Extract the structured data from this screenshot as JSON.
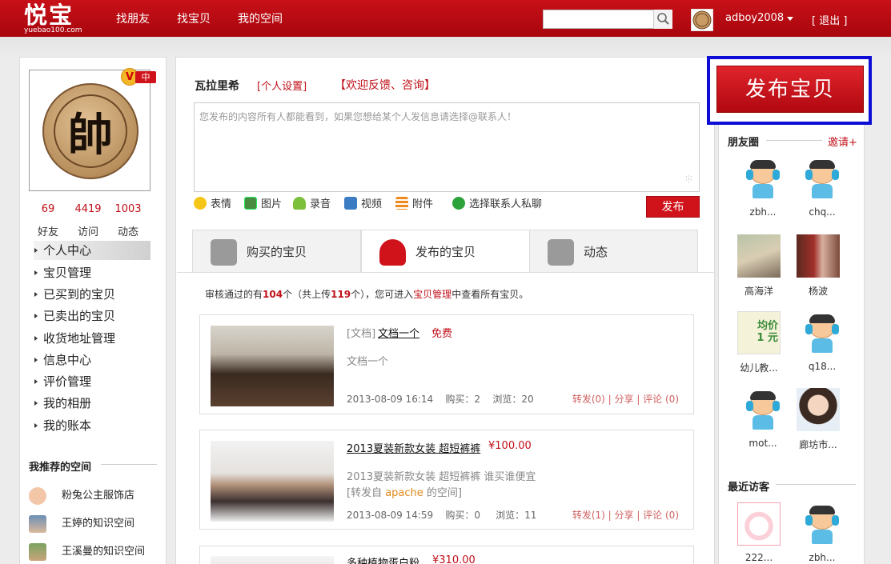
{
  "header": {
    "logo": "悦宝",
    "logo_sub": "yuebao100.com",
    "nav": [
      "找朋友",
      "找宝贝",
      "我的空间"
    ],
    "search_placeholder": "",
    "username": "adboy2008",
    "logout": "[ 退出 ]"
  },
  "profile": {
    "vip_badge": "V",
    "vip_level": "中",
    "avatar_char": "帥",
    "stats": [
      {
        "value": "69",
        "label": "好友"
      },
      {
        "value": "4419",
        "label": "访问"
      },
      {
        "value": "1003",
        "label": "动态"
      }
    ]
  },
  "sidebar": {
    "menu": [
      "个人中心",
      "宝贝管理",
      "已买到的宝贝",
      "已卖出的宝贝",
      "收货地址管理",
      "信息中心",
      "评价管理",
      "我的相册",
      "我的账本"
    ],
    "recommended_title": "我推荐的空间",
    "recommended": [
      "粉兔公主服饰店",
      "王婷的知识空间",
      "王溪曼的知识空间"
    ]
  },
  "composer": {
    "owner": "瓦拉里希",
    "settings": "[个人设置]",
    "feedback": "【欢迎反馈、咨询】",
    "placeholder": "您发布的内容所有人都能看到，如果您想给某个人发信息请选择@联系人！",
    "tools": [
      "表情",
      "图片",
      "录音",
      "视频",
      "附件",
      "选择联系人私聊"
    ],
    "submit": "发布"
  },
  "tabs": [
    "购买的宝贝",
    "发布的宝贝",
    "动态"
  ],
  "audit": {
    "prefix": "审核通过的有",
    "approved": "104",
    "mid1": "个（共上传",
    "uploaded": "119",
    "mid2": "个），您可进入",
    "link": "宝贝管理",
    "suffix": "中查看所有宝贝。"
  },
  "items": [
    {
      "type": "[文档]",
      "title": "文档一个",
      "price": "免费",
      "desc": "文档一个",
      "forward_note": "",
      "forward_src": "",
      "forward_tail": "",
      "date": "2013-08-09 16:14",
      "bought": "购买：2",
      "views": "浏览：20",
      "actions": "转发(0) | 分享 | 评论 (0)"
    },
    {
      "type": "",
      "title": "2013夏装新款女装 超短裤裤",
      "price": "¥100.00",
      "desc": "2013夏装新款女装 超短裤裤 谁买谁便宜",
      "forward_note": "[转发自 ",
      "forward_src": "apache",
      "forward_tail": " 的空间]",
      "date": "2013-08-09 14:59",
      "bought": "购买：0",
      "views": "浏览：11",
      "actions": "转发(1) | 分享 | 评论 (0)"
    },
    {
      "type": "",
      "title": "多种植物蛋白粉",
      "price": "¥310.00"
    }
  ],
  "right": {
    "publish": "发布宝贝",
    "friends_title": "朋友圈",
    "invite": "邀请+",
    "friends": [
      "zbh...",
      "chq...",
      "高海洋",
      "杨波",
      "幼儿教...",
      "q18...",
      "mot...",
      "廊坊市..."
    ],
    "promo_text": "均价",
    "promo_price": "1 元",
    "visitors_title": "最近访客",
    "visitors": [
      "222...",
      "zbh..."
    ]
  },
  "colors": {
    "brand_red": "#c0101a",
    "highlight_border": "#0d0dd6"
  }
}
